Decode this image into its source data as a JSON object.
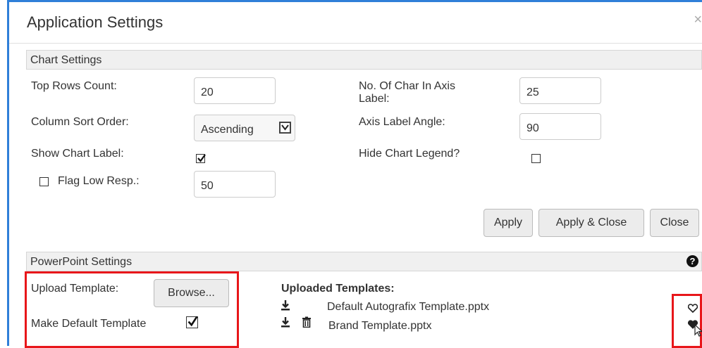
{
  "dialog": {
    "title": "Application Settings",
    "close": "×"
  },
  "chart_settings": {
    "header": "Chart Settings",
    "top_rows": {
      "label": "Top Rows Count:",
      "value": "20"
    },
    "char_axis": {
      "label_line1": "No. Of Char In Axis",
      "label_line2": "Label:",
      "value": "25"
    },
    "sort_order": {
      "label": "Column Sort Order:",
      "value": "Ascending"
    },
    "axis_angle": {
      "label": "Axis Label Angle:",
      "value": "90"
    },
    "show_label": {
      "label": "Show Chart Label:",
      "checked": true
    },
    "hide_legend": {
      "label": "Hide Chart Legend?",
      "checked": false
    },
    "flag_low": {
      "label": "Flag Low Resp.:",
      "checked": false,
      "value": "50"
    },
    "buttons": {
      "apply": "Apply",
      "apply_close": "Apply & Close",
      "close": "Close"
    }
  },
  "ppt_settings": {
    "header": "PowerPoint Settings",
    "help_icon": "?",
    "upload": {
      "label": "Upload Template:",
      "button": "Browse..."
    },
    "make_default": {
      "label": "Make Default Template",
      "checked": true
    },
    "uploaded": {
      "header": "Uploaded Templates:",
      "items": [
        {
          "name": "Default Autografix Template.pptx",
          "favorite": false
        },
        {
          "name": "Brand Template.pptx",
          "favorite": true
        }
      ]
    }
  },
  "colors": {
    "accent": "#2f7fd8",
    "highlight": "#e8161a"
  }
}
